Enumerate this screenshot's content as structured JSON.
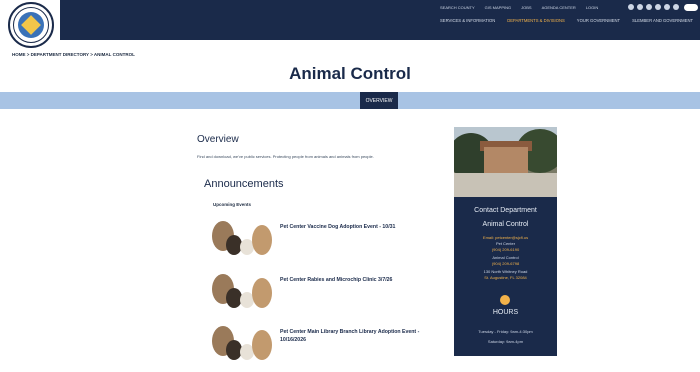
{
  "header": {
    "logo_text": "ST. JOHNS COUNTY",
    "top_links": [
      "SEARCH COUNTY",
      "GIS MAPPING",
      "JOBS",
      "AGENDA CENTER",
      "LOGIN"
    ],
    "main_nav": [
      {
        "label": "SERVICES & INFORMATION",
        "active": false
      },
      {
        "label": "DEPARTMENTS & DIVISIONS",
        "active": true
      },
      {
        "label": "YOUR GOVERNMENT",
        "active": false
      },
      {
        "label": "SLEMBER AND GOVERNMENT",
        "active": false
      }
    ]
  },
  "breadcrumb": "HOME > DEPARTMENT DIRECTORY > ANIMAL CONTROL",
  "page_title": "Animal Control",
  "subnav": {
    "overview_label": "OVERVIEW"
  },
  "overview": {
    "title": "Overview",
    "text": "Find and download, we've public services. Protecting people from animals and animals from people."
  },
  "announcements": {
    "title": "Announcements",
    "upcoming_label": "Upcoming Events",
    "items": [
      {
        "text": "Pet Center Vaccine Dog Adoption Event - 10/31"
      },
      {
        "text": "Pet Center Rabies and Microchip Clinic 3/7/26"
      },
      {
        "text": "Pet Center Main Library Branch Library Adoption Event - 10/16/2026"
      }
    ]
  },
  "sidebar": {
    "contact_title": "Contact Department",
    "dept_name": "Animal Control",
    "lines": [
      {
        "text": "Email: petcenter@sjcfl.us",
        "link": true
      },
      {
        "text": "Pet Center",
        "link": false
      },
      {
        "text": "(904) 209-6190",
        "link": true
      },
      {
        "text": "Animal Control",
        "link": false
      },
      {
        "text": "(904) 209-6798",
        "link": true
      },
      {
        "text": "130 North Whitney Road",
        "link": false
      },
      {
        "text": "St. Augustine, FL 32084",
        "link": true
      }
    ],
    "hours_title": "HOURS",
    "hours_lines": [
      "Tuesday - Friday: 9am-4:30pm",
      "Saturday: 9am-4pm"
    ]
  },
  "colors": {
    "navy": "#1a2a4a",
    "subnav": "#a8c3e4",
    "accent": "#f2b24a"
  }
}
